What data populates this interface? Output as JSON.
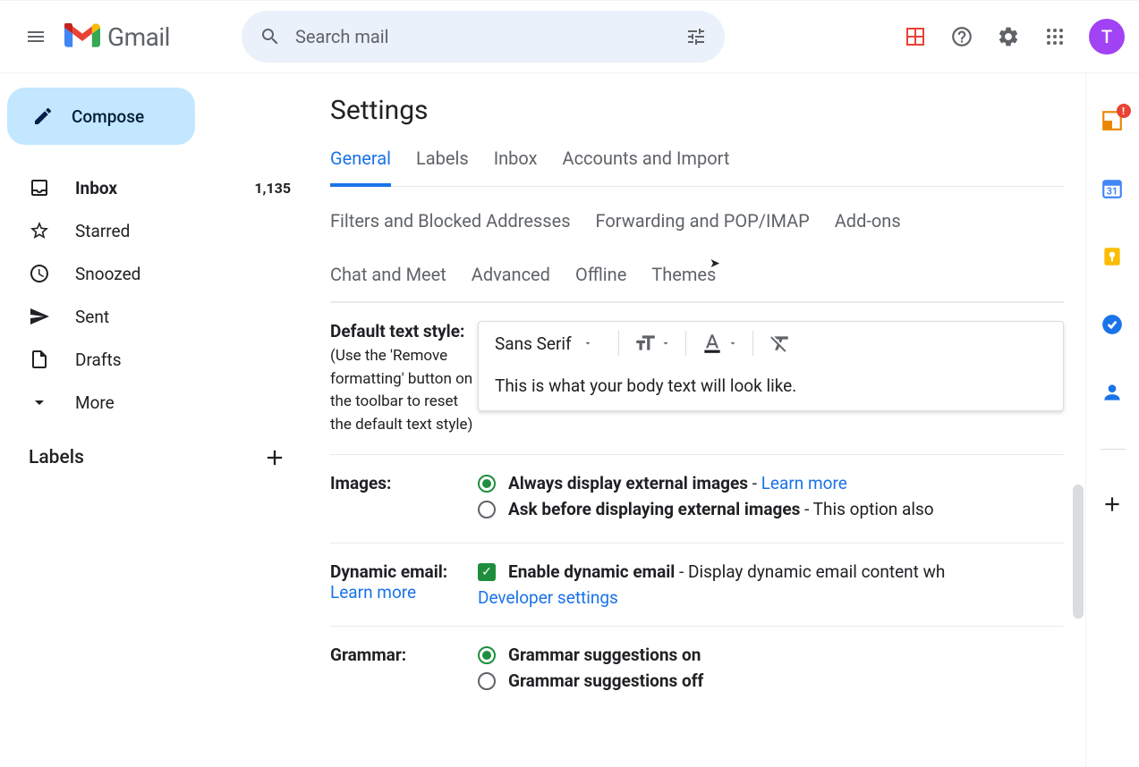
{
  "header": {
    "logo_text": "Gmail",
    "search_placeholder": "Search mail",
    "avatar_initial": "T"
  },
  "compose": {
    "label": "Compose"
  },
  "sidebar": {
    "items": [
      {
        "icon": "inbox",
        "label": "Inbox",
        "count": "1,135",
        "active": true
      },
      {
        "icon": "star",
        "label": "Starred"
      },
      {
        "icon": "clock",
        "label": "Snoozed"
      },
      {
        "icon": "send",
        "label": "Sent"
      },
      {
        "icon": "file",
        "label": "Drafts"
      },
      {
        "icon": "chevron-down",
        "label": "More"
      }
    ],
    "labels_header": "Labels"
  },
  "page": {
    "title": "Settings",
    "tabs": [
      "General",
      "Labels",
      "Inbox",
      "Accounts and Import",
      "Filters and Blocked Addresses",
      "Forwarding and POP/IMAP",
      "Add-ons",
      "Chat and Meet",
      "Advanced",
      "Offline",
      "Themes"
    ],
    "active_tab": "General"
  },
  "settings": {
    "text_style": {
      "label": "Default text style:",
      "desc": "(Use the 'Remove formatting' button on the toolbar to reset the default text style)",
      "font": "Sans Serif",
      "preview": "This is what your body text will look like."
    },
    "images": {
      "label": "Images:",
      "opt1": "Always display external images",
      "opt1_suffix": " - ",
      "learn_more": "Learn more",
      "opt2": "Ask before displaying external images",
      "opt2_suffix": " - This option also "
    },
    "dynamic": {
      "label": "Dynamic email:",
      "learn_more": "Learn more",
      "checkbox_label": "Enable dynamic email",
      "suffix": " - Display dynamic email content wh",
      "dev_settings": "Developer settings"
    },
    "grammar": {
      "label": "Grammar:",
      "on": "Grammar suggestions on",
      "off": "Grammar suggestions off"
    }
  }
}
